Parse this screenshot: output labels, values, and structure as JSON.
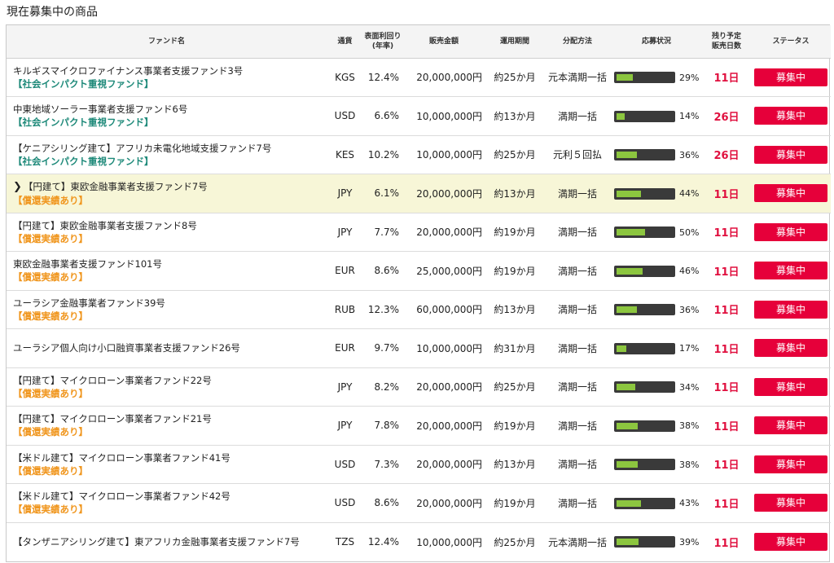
{
  "page": {
    "title": "現在募集中の商品"
  },
  "headers": {
    "name": "ファンド名",
    "currency": "通貨",
    "rate_line1": "表面利回り",
    "rate_line2": "(年率)",
    "amount": "販売金額",
    "period": "運用期間",
    "distribution": "分配方法",
    "progress": "応募状況",
    "days_line1": "残り予定",
    "days_line2": "販売日数",
    "status": "ステータス"
  },
  "colors": {
    "impact_tag": "#1f8a7a",
    "redeem_tag": "#f0961e",
    "days": "#e0103f",
    "status_button": "#e6003a",
    "progress_fill": "#8cc63f",
    "highlight_row": "#f7f6d7"
  },
  "funds": [
    {
      "name": "キルギスマイクロファイナンス事業者支援ファンド3号",
      "tag": "【社会インパクト重視ファンド】",
      "tag_type": "impact",
      "currency": "KGS",
      "rate": "12.4%",
      "amount": "20,000,000円",
      "period": "約25か月",
      "distribution": "元本満期一括",
      "progress": "29%",
      "progress_value": 29,
      "days": "11日",
      "status": "募集中",
      "selected": false
    },
    {
      "name": "中東地域ソーラー事業者支援ファンド6号",
      "tag": "【社会インパクト重視ファンド】",
      "tag_type": "impact",
      "currency": "USD",
      "rate": "6.6%",
      "amount": "10,000,000円",
      "period": "約13か月",
      "distribution": "満期一括",
      "progress": "14%",
      "progress_value": 14,
      "days": "26日",
      "status": "募集中",
      "selected": false
    },
    {
      "name": "【ケニアシリング建て】アフリカ未電化地域支援ファンド7号",
      "tag": "【社会インパクト重視ファンド】",
      "tag_type": "impact",
      "currency": "KES",
      "rate": "10.2%",
      "amount": "10,000,000円",
      "period": "約25か月",
      "distribution": "元利５回払",
      "progress": "36%",
      "progress_value": 36,
      "days": "26日",
      "status": "募集中",
      "selected": false
    },
    {
      "name": "【円建て】東欧金融事業者支援ファンド7号",
      "tag": "【償還実績あり】",
      "tag_type": "redeem",
      "currency": "JPY",
      "rate": "6.1%",
      "amount": "20,000,000円",
      "period": "約13か月",
      "distribution": "満期一括",
      "progress": "44%",
      "progress_value": 44,
      "days": "11日",
      "status": "募集中",
      "selected": true
    },
    {
      "name": "【円建て】東欧金融事業者支援ファンド8号",
      "tag": "【償還実績あり】",
      "tag_type": "redeem",
      "currency": "JPY",
      "rate": "7.7%",
      "amount": "20,000,000円",
      "period": "約19か月",
      "distribution": "満期一括",
      "progress": "50%",
      "progress_value": 50,
      "days": "11日",
      "status": "募集中",
      "selected": false
    },
    {
      "name": "東欧金融事業者支援ファンド101号",
      "tag": "【償還実績あり】",
      "tag_type": "redeem",
      "currency": "EUR",
      "rate": "8.6%",
      "amount": "25,000,000円",
      "period": "約19か月",
      "distribution": "満期一括",
      "progress": "46%",
      "progress_value": 46,
      "days": "11日",
      "status": "募集中",
      "selected": false
    },
    {
      "name": "ユーラシア金融事業者ファンド39号",
      "tag": "【償還実績あり】",
      "tag_type": "redeem",
      "currency": "RUB",
      "rate": "12.3%",
      "amount": "60,000,000円",
      "period": "約13か月",
      "distribution": "満期一括",
      "progress": "36%",
      "progress_value": 36,
      "days": "11日",
      "status": "募集中",
      "selected": false
    },
    {
      "name": "ユーラシア個人向け小口融資事業者支援ファンド26号",
      "tag": "",
      "tag_type": "",
      "currency": "EUR",
      "rate": "9.7%",
      "amount": "10,000,000円",
      "period": "約31か月",
      "distribution": "満期一括",
      "progress": "17%",
      "progress_value": 17,
      "days": "11日",
      "status": "募集中",
      "selected": false
    },
    {
      "name": "【円建て】マイクロローン事業者ファンド22号",
      "tag": "【償還実績あり】",
      "tag_type": "redeem",
      "currency": "JPY",
      "rate": "8.2%",
      "amount": "20,000,000円",
      "period": "約25か月",
      "distribution": "満期一括",
      "progress": "34%",
      "progress_value": 34,
      "days": "11日",
      "status": "募集中",
      "selected": false
    },
    {
      "name": "【円建て】マイクロローン事業者ファンド21号",
      "tag": "【償還実績あり】",
      "tag_type": "redeem",
      "currency": "JPY",
      "rate": "7.8%",
      "amount": "20,000,000円",
      "period": "約19か月",
      "distribution": "満期一括",
      "progress": "38%",
      "progress_value": 38,
      "days": "11日",
      "status": "募集中",
      "selected": false
    },
    {
      "name": "【米ドル建て】マイクロローン事業者ファンド41号",
      "tag": "【償還実績あり】",
      "tag_type": "redeem",
      "currency": "USD",
      "rate": "7.3%",
      "amount": "20,000,000円",
      "period": "約13か月",
      "distribution": "満期一括",
      "progress": "38%",
      "progress_value": 38,
      "days": "11日",
      "status": "募集中",
      "selected": false
    },
    {
      "name": "【米ドル建て】マイクロローン事業者ファンド42号",
      "tag": "【償還実績あり】",
      "tag_type": "redeem",
      "currency": "USD",
      "rate": "8.6%",
      "amount": "20,000,000円",
      "period": "約19か月",
      "distribution": "満期一括",
      "progress": "43%",
      "progress_value": 43,
      "days": "11日",
      "status": "募集中",
      "selected": false
    },
    {
      "name": "【タンザニアシリング建て】東アフリカ金融事業者支援ファンド7号",
      "tag": "",
      "tag_type": "",
      "currency": "TZS",
      "rate": "12.4%",
      "amount": "10,000,000円",
      "period": "約25か月",
      "distribution": "元本満期一括",
      "progress": "39%",
      "progress_value": 39,
      "days": "11日",
      "status": "募集中",
      "selected": false
    }
  ]
}
